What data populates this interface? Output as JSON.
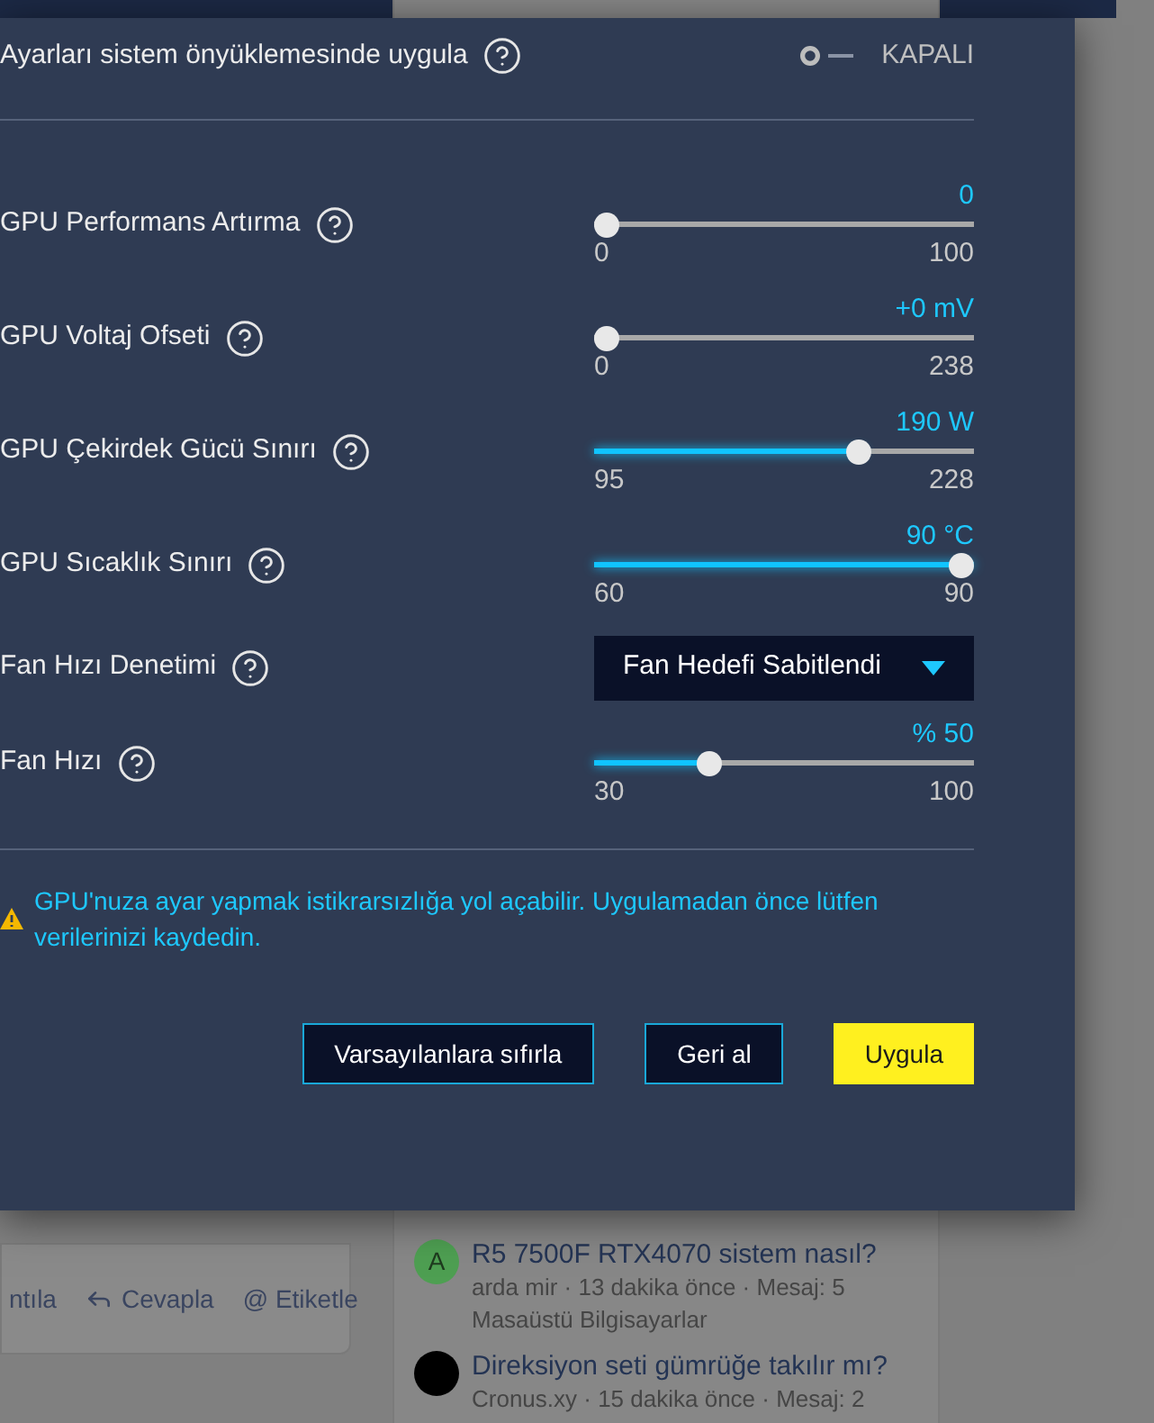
{
  "background": {
    "post_actions": [
      {
        "kind": "text",
        "label": "ntıla"
      },
      {
        "kind": "reply",
        "label": "Cevapla"
      },
      {
        "kind": "text",
        "label": "@ Etiketle"
      }
    ],
    "threads": [
      {
        "avatar": "A",
        "color": "#4e9f52",
        "title": "R5 7500F RTX4070 sistem nasıl?",
        "meta": "arda mir · 13 dakika önce · Mesaj: 5",
        "forum": "Masaüstü Bilgisayarlar"
      },
      {
        "color": "#000000",
        "title": "Direksiyon seti gümrüğe takılır mı?",
        "meta": "Cronus.xy · 15 dakika önce · Mesaj: 2"
      }
    ]
  },
  "panel": {
    "boot_setting": {
      "label": "Ayarları sistem önyüklemesinde uygula",
      "on": false,
      "state_label": "KAPALI"
    },
    "settings": [
      {
        "kind": "slider",
        "label": "GPU Performans Artırma",
        "value": "0",
        "min": "0",
        "max": "100",
        "level": 0
      },
      {
        "kind": "slider",
        "label": "GPU Voltaj Ofseti",
        "value": "+0 mV",
        "min": "0",
        "max": "238",
        "level": 0
      },
      {
        "kind": "slider",
        "label": "GPU Çekirdek Gücü Sınırı",
        "value": "190 W",
        "min": "95",
        "max": "228",
        "level": 0.71
      },
      {
        "kind": "slider",
        "label": "GPU Sıcaklık Sınırı",
        "value": "90 °C",
        "min": "60",
        "max": "90",
        "level": 1
      },
      {
        "kind": "dropdown",
        "label": "Fan Hızı Denetimi",
        "value": "Fan Hedefi Sabitlendi"
      },
      {
        "kind": "slider",
        "label": "Fan Hızı",
        "value": "% 50",
        "min": "30",
        "max": "100",
        "level": 0.29
      }
    ],
    "warning": "GPU'nuza ayar yapmak istikrarsızlığa yol açabilir. Uygulamadan önce lütfen verilerinizi kaydedin.",
    "buttons": [
      {
        "kind": "secondary",
        "label": "Varsayılanlara sıfırla"
      },
      {
        "kind": "secondary",
        "label": "Geri al"
      },
      {
        "kind": "primary",
        "label": "Uygula"
      }
    ]
  }
}
